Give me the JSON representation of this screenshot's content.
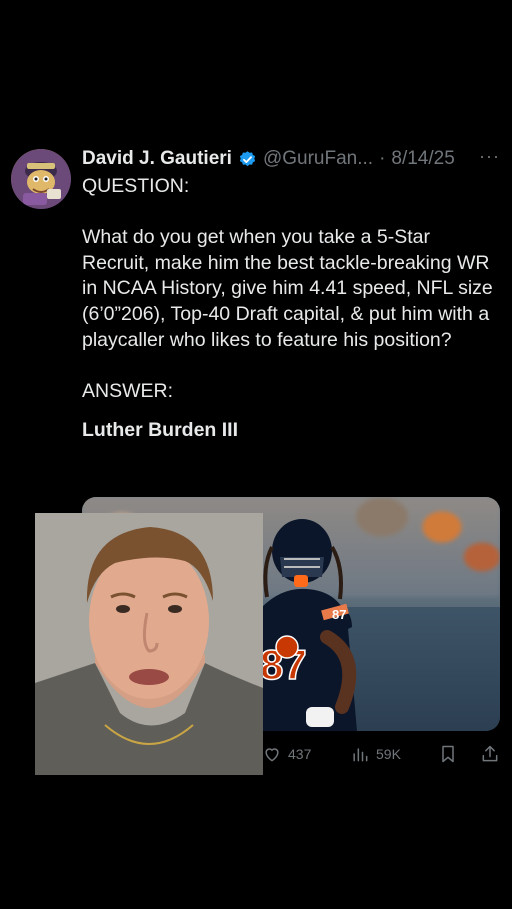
{
  "tweet": {
    "author": {
      "name": "David J. Gautieri",
      "handle": "@GuruFan...",
      "separator": "·",
      "date": "8/14/25",
      "avatar_icon": "mascot-avatar-icon",
      "verified_icon": "verified-badge-icon",
      "verified_color": "#1d9bf0"
    },
    "more_label": "···",
    "body": {
      "question": "QUESTION:",
      "paragraph": "What do you get when you take a 5-Star Recruit, make him the best tackle-breaking WR in NCAA History, give him 4.41 speed, NFL size (6’0”206), Top-40 Draft capital, & put him with a playcaller who likes to feature his position?",
      "answer": "ANSWER:",
      "answer_name": "Luther Burden III"
    },
    "media": {
      "jersey_number": "87",
      "jersey_color": "#0b162a",
      "accent_color": "#c83803"
    },
    "actions": {
      "likes": "437",
      "views": "59K",
      "like_icon": "heart-icon",
      "views_icon": "bar-chart-icon",
      "bookmark_icon": "bookmark-icon",
      "share_icon": "share-icon"
    }
  },
  "overlay": {
    "face_cam_icon": "face-cam-overlay"
  },
  "colors": {
    "background": "#000000",
    "text": "#e7e9ea",
    "muted": "#71767b"
  }
}
